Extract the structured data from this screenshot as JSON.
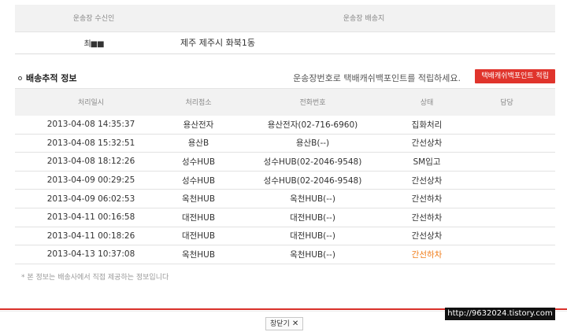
{
  "receiver": {
    "col_receiver": "운송장 수신인",
    "col_destination": "운송장 배송지",
    "receiver_name": "최■■",
    "address": "제주 제주시 화북1동"
  },
  "tracking": {
    "title": "배송추적 정보",
    "note": "운송장번호로 택배캐쉬백포인트를 적립하세요.",
    "button_label": "택배캐쉬백포인트 적립",
    "columns": [
      "처리일시",
      "처리점소",
      "전화번호",
      "상태",
      "담당"
    ],
    "rows": [
      {
        "datetime": "2013-04-08 14:35:37",
        "place": "용산전자",
        "phone": "용산전자(02-716-6960)",
        "status": "집화처리",
        "staff": ""
      },
      {
        "datetime": "2013-04-08 15:32:51",
        "place": "용산B",
        "phone": "용산B(--)",
        "status": "간선상차",
        "staff": ""
      },
      {
        "datetime": "2013-04-08 18:12:26",
        "place": "성수HUB",
        "phone": "성수HUB(02-2046-9548)",
        "status": "SM입고",
        "staff": ""
      },
      {
        "datetime": "2013-04-09 00:29:25",
        "place": "성수HUB",
        "phone": "성수HUB(02-2046-9548)",
        "status": "간선상차",
        "staff": ""
      },
      {
        "datetime": "2013-04-09 06:02:53",
        "place": "옥천HUB",
        "phone": "옥천HUB(--)",
        "status": "간선하차",
        "staff": ""
      },
      {
        "datetime": "2013-04-11 00:16:58",
        "place": "대전HUB",
        "phone": "대전HUB(--)",
        "status": "간선하차",
        "staff": ""
      },
      {
        "datetime": "2013-04-11 00:18:26",
        "place": "대전HUB",
        "phone": "대전HUB(--)",
        "status": "간선상차",
        "staff": ""
      },
      {
        "datetime": "2013-04-13 10:37:08",
        "place": "옥천HUB",
        "phone": "옥천HUB(--)",
        "status": "간선하차",
        "staff": ""
      }
    ],
    "footnote": "* 본 정보는 배송사에서 직접 제공하는 정보입니다"
  },
  "close_label": "창닫기",
  "close_icon": "close-x",
  "watermark": "http://9632024.tistory.com",
  "colors": {
    "accent_red": "#e0342c",
    "last_status": "#f07d1a"
  }
}
